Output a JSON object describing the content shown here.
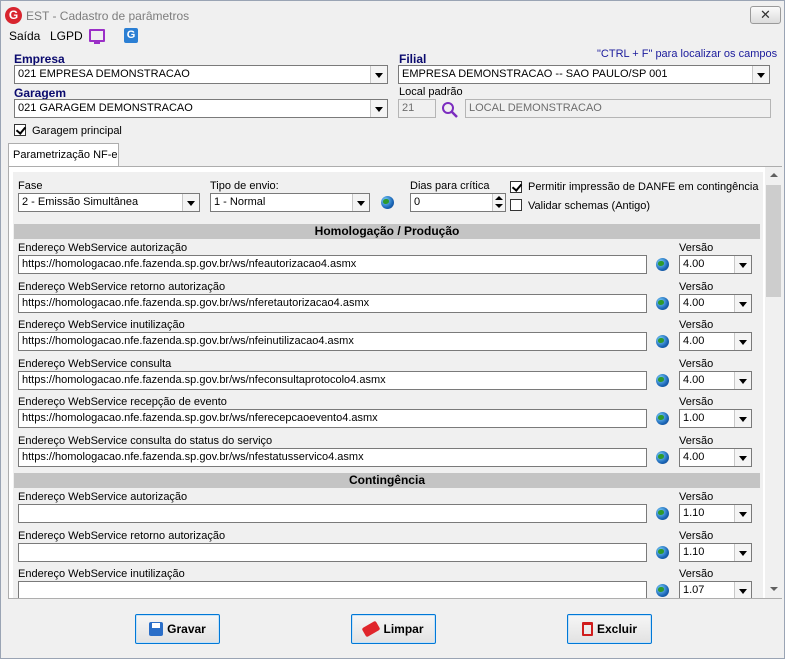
{
  "window": {
    "title": "EST - Cadastro de parâmetros",
    "app_icon": "G",
    "close_label": "✕"
  },
  "menu": {
    "items": [
      "Saída",
      "LGPD"
    ]
  },
  "header": {
    "empresa_label": "Empresa",
    "empresa_value": "021 EMPRESA DEMONSTRACAO",
    "filial_label": "Filial",
    "filial_value": "EMPRESA DEMONSTRACAO -- SAO PAULO/SP 001",
    "hint": "\"CTRL + F\" para localizar os campos",
    "garagem_label": "Garagem",
    "garagem_value": "021 GARAGEM DEMONSTRACAO",
    "local_label": "Local padrão",
    "local_code": "21",
    "local_name": "LOCAL DEMONSTRACAO",
    "garagem_principal_label": "Garagem principal",
    "garagem_principal_checked": true
  },
  "tabs": [
    {
      "label": "Parametrização NF-e",
      "active": true
    }
  ],
  "nfe": {
    "fase_label": "Fase",
    "fase_value": "2 - Emissão Simultânea",
    "tipo_label": "Tipo de envio:",
    "tipo_value": "1 - Normal",
    "dias_label": "Dias para crítica",
    "dias_value": "0",
    "permitir_label": "Permitir impressão de DANFE em contingência",
    "permitir_checked": true,
    "validar_label": "Validar schemas (Antigo)",
    "validar_checked": false,
    "homolog_title": "Homologação / Produção",
    "contingencia_title": "Contingência",
    "versao_label": "Versão",
    "homolog_rows": [
      {
        "label": "Endereço WebService autorização",
        "url": "https://homologacao.nfe.fazenda.sp.gov.br/ws/nfeautorizacao4.asmx",
        "version": "4.00"
      },
      {
        "label": "Endereço WebService retorno autorização",
        "url": "https://homologacao.nfe.fazenda.sp.gov.br/ws/nferetautorizacao4.asmx",
        "version": "4.00"
      },
      {
        "label": "Endereço WebService inutilização",
        "url": "https://homologacao.nfe.fazenda.sp.gov.br/ws/nfeinutilizacao4.asmx",
        "version": "4.00"
      },
      {
        "label": "Endereço WebService consulta",
        "url": "https://homologacao.nfe.fazenda.sp.gov.br/ws/nfeconsultaprotocolo4.asmx",
        "version": "4.00"
      },
      {
        "label": "Endereço WebService recepção de evento",
        "url": "https://homologacao.nfe.fazenda.sp.gov.br/ws/nferecepcaoevento4.asmx",
        "version": "1.00"
      },
      {
        "label": "Endereço WebService consulta do status do serviço",
        "url": "https://homologacao.nfe.fazenda.sp.gov.br/ws/nfestatusservico4.asmx",
        "version": "4.00"
      }
    ],
    "contingencia_rows": [
      {
        "label": "Endereço WebService autorização",
        "url": "",
        "version": "1.10"
      },
      {
        "label": "Endereço WebService retorno autorização",
        "url": "",
        "version": "1.10"
      },
      {
        "label": "Endereço WebService inutilização",
        "url": "",
        "version": "1.07"
      }
    ]
  },
  "buttons": {
    "save": "Gravar",
    "clear": "Limpar",
    "delete": "Excluir"
  }
}
